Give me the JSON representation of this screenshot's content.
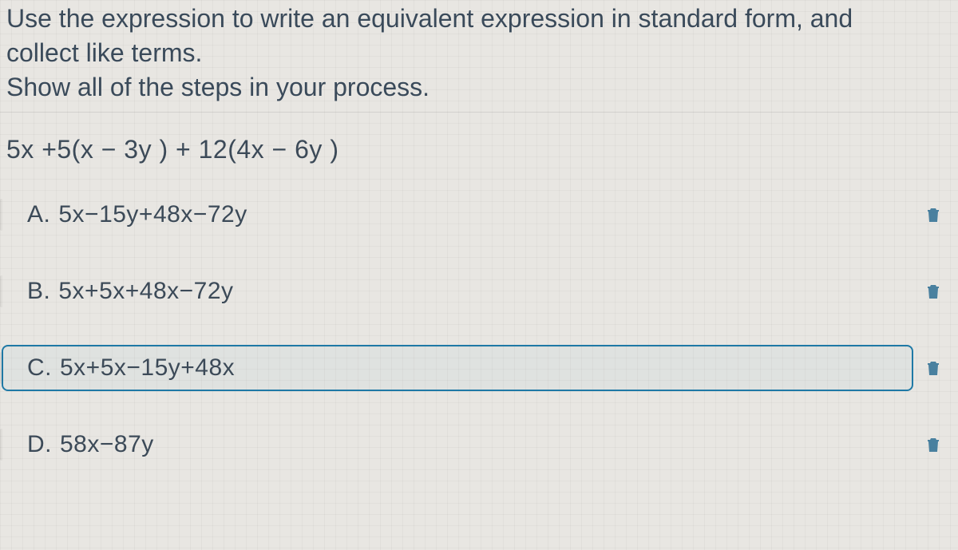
{
  "question": {
    "line1": "Use the expression to write an equivalent expression in standard form, and",
    "line2": "collect like terms.",
    "line3": "Show all of the steps in your process."
  },
  "expression": "5x +5(x − 3y ) +   12(4x − 6y )",
  "options": [
    {
      "letter": "A.",
      "text": "5x−15y+48x−72y",
      "selected": false
    },
    {
      "letter": "B.",
      "text": "5x+5x+48x−72y",
      "selected": false
    },
    {
      "letter": "C.",
      "text": "5x+5x−15y+48x",
      "selected": true
    },
    {
      "letter": "D.",
      "text": "58x−87y",
      "selected": false
    }
  ],
  "icons": {
    "trash": "delete"
  }
}
